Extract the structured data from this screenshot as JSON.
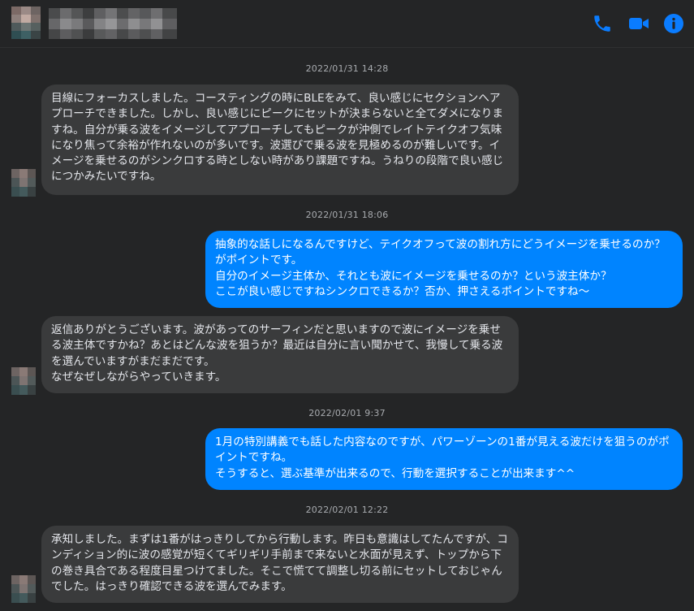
{
  "header": {
    "icons": {
      "call": "phone-icon",
      "video": "video-camera-icon",
      "info": "info-icon"
    },
    "accent_color": "#0084ff"
  },
  "messages": [
    {
      "timestamp": "2022/01/31 14:28",
      "direction": "incoming",
      "text": "目線にフォーカスしました。コースティングの時にBLEをみて、良い感じにセクションへアプローチできました。しかし、良い感じにピークにセットが決まらないと全てダメになりますね。自分が乗る波をイメージしてアプローチしてもピークが沖側でレイトテイクオフ気味になり焦って余裕が作れないのが多いです。波選びで乗る波を見極めるのが難しいです。イメージを乗せるのがシンクロする時としない時があり課題ですね。うねりの段階で良い感じにつかみたいですね。"
    },
    {
      "timestamp": "2022/01/31 18:06",
      "direction": "outgoing",
      "text": "抽象的な話しになるんですけど、テイクオフって波の割れ方にどうイメージを乗せるのか？がポイントです。\n自分のイメージ主体か、それとも波にイメージを乗せるのか？という波主体か？\nここが良い感じですねシンクロできるか？否か、押さえるポイントですね〜"
    },
    {
      "timestamp": "",
      "direction": "incoming",
      "text": "返信ありがとうございます。波があってのサーフィンだと思いますので波にイメージを乗せる波主体ですかね？あとはどんな波を狙うか？最近は自分に言い聞かせて、我慢して乗る波を選んでいますがまだまだです。\nなぜなぜしながらやっていきます。"
    },
    {
      "timestamp": "2022/02/01 9:37",
      "direction": "outgoing",
      "text": "1月の特別講義でも話した内容なのですが、パワーゾーンの1番が見える波だけを狙うのがポイントですね。\nそうすると、選ぶ基準が出来るので、行動を選択することが出来ます^^"
    },
    {
      "timestamp": "2022/02/01 12:22",
      "direction": "incoming",
      "text": "承知しました。まずは1番がはっきりしてから行動します。昨日も意識はしてたんですが、コンディション的に波の感覚が短くてギリギリ手前まで来ないと水面が見えず、トップから下の巻き具合である程度目星つけてました。そこで慌てて調整し切る前にセットしておじゃんでした。はっきり確認できる波を選んでみます。"
    }
  ]
}
